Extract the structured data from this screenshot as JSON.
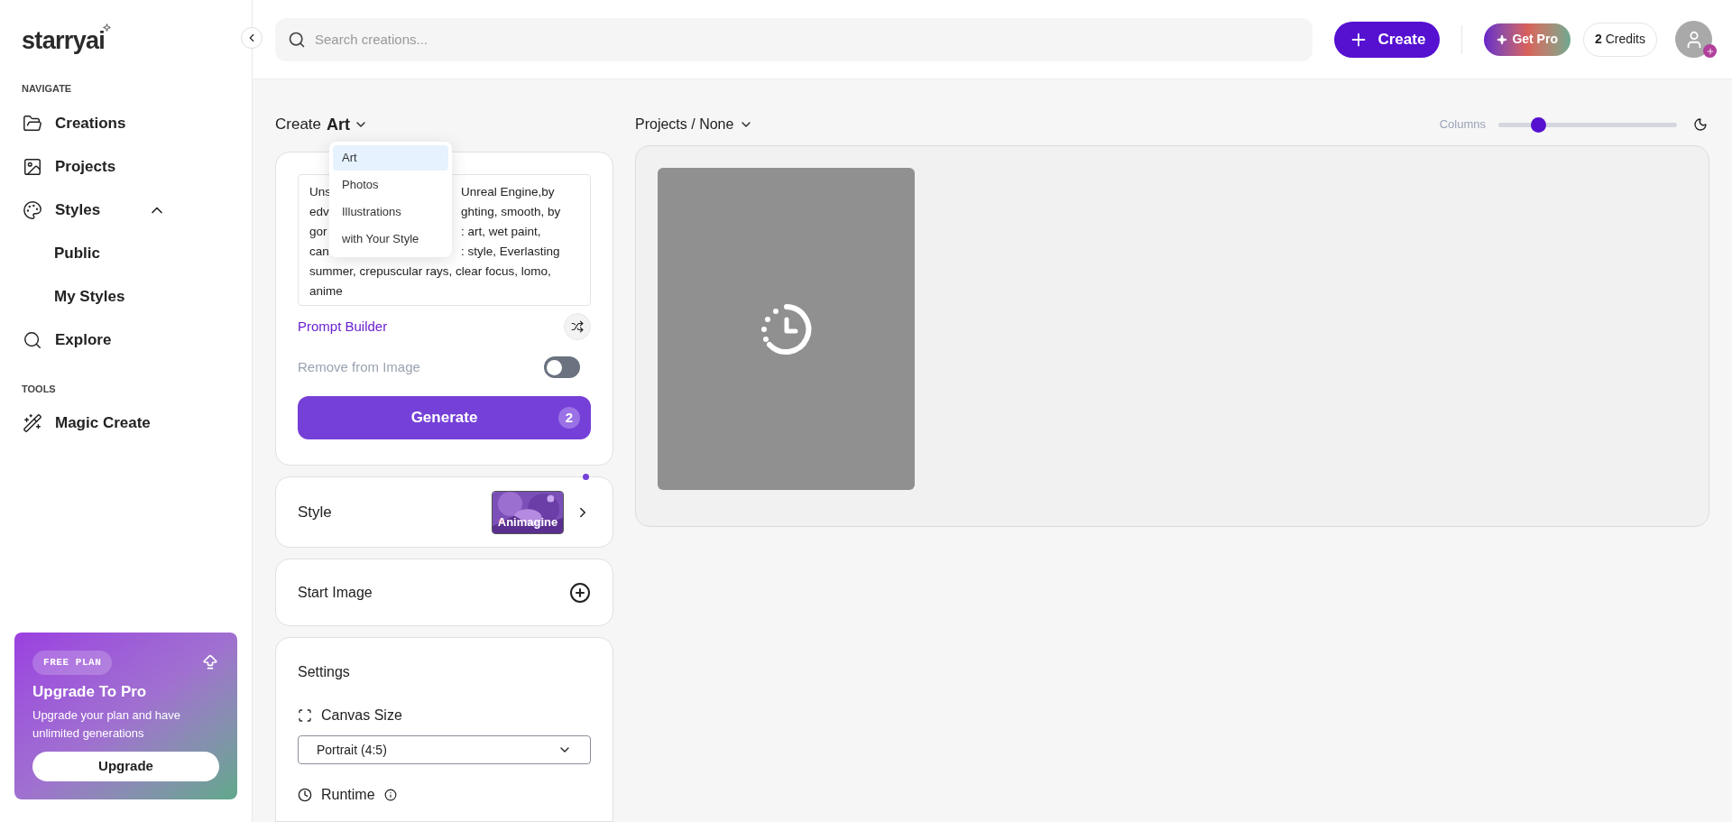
{
  "sidebar": {
    "logo": "starryai",
    "sections": [
      {
        "title": "NAVIGATE",
        "items": [
          {
            "label": "Creations"
          },
          {
            "label": "Projects"
          },
          {
            "label": "Styles",
            "expanded": true,
            "children": [
              {
                "label": "Public"
              },
              {
                "label": "My Styles"
              }
            ]
          },
          {
            "label": "Explore"
          }
        ]
      },
      {
        "title": "TOOLS",
        "items": [
          {
            "label": "Magic Create"
          }
        ]
      }
    ],
    "upgrade_card": {
      "badge": "FREE PLAN",
      "title": "Upgrade To Pro",
      "text": "Upgrade your plan and have unlimited generations",
      "button": "Upgrade"
    }
  },
  "header": {
    "search": {
      "placeholder": "Search creations..."
    },
    "create_button": "Create",
    "get_pro_button": "Get Pro",
    "credits": "**2** Credits"
  },
  "create_panel": {
    "prefix": "Create",
    "mode": "Art",
    "mode_menu": [
      {
        "label": "Art",
        "selected": true
      },
      {
        "label": "Photos",
        "selected": false
      },
      {
        "label": "Illustrations",
        "selected": false
      },
      {
        "label": "with Your Style",
        "selected": false
      }
    ],
    "prompt_lines": [
      [
        "Uns",
        "Unreal Engine,by"
      ],
      [
        "edv",
        "ghting, smooth, by"
      ],
      [
        "gor",
        ": art, wet paint,"
      ],
      [
        "can",
        ": style, Everlasting"
      ],
      [
        "summer, crepuscular rays, clear focus, lomo,"
      ],
      [
        "anime"
      ]
    ],
    "prompt_builder": "Prompt Builder",
    "remove_from_image": {
      "label": "Remove from Image",
      "on": false
    },
    "generate": {
      "label": "Generate",
      "badge": "2"
    },
    "style": {
      "label": "Style",
      "thumbnail_label": "Animagine"
    },
    "start_image": {
      "label": "Start Image"
    },
    "settings": {
      "title": "Settings",
      "canvas_size": {
        "label": "Canvas Size",
        "value": "Portrait (4:5)"
      },
      "runtime": {
        "label": "Runtime"
      }
    }
  },
  "gallery": {
    "breadcrumb": "Projects / None",
    "columns": {
      "label": "Columns",
      "level": 0.22
    },
    "items": [
      {
        "kind": "loading"
      }
    ]
  }
}
